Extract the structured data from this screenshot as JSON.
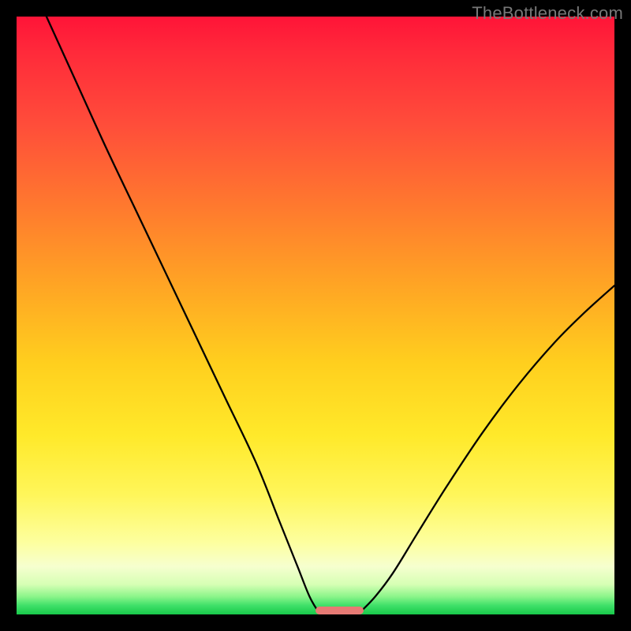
{
  "watermark": "TheBottleneck.com",
  "chart_data": {
    "type": "line",
    "title": "",
    "xlabel": "",
    "ylabel": "",
    "xlim": [
      0,
      100
    ],
    "ylim": [
      0,
      100
    ],
    "grid": false,
    "legend": false,
    "description": "Bottleneck curve: two descending arms meeting at a minimum, over a vertical heat gradient (red high → green low).",
    "series": [
      {
        "name": "left-arm",
        "x": [
          5,
          10,
          15,
          20,
          25,
          30,
          35,
          40,
          44,
          47,
          49,
          50.5
        ],
        "values": [
          100,
          89,
          78,
          67.5,
          57,
          46.5,
          36,
          25.5,
          15.5,
          8,
          3,
          0.4
        ]
      },
      {
        "name": "right-arm",
        "x": [
          57.5,
          60,
          63,
          67,
          72,
          78,
          84,
          90,
          95,
          100
        ],
        "values": [
          0.4,
          3,
          7,
          13.5,
          21.5,
          30.5,
          38.5,
          45.5,
          50.5,
          55
        ]
      }
    ],
    "minimum_marker": {
      "x_start": 50,
      "x_end": 58,
      "y": 0
    },
    "gradient_stops": [
      {
        "pos": 0,
        "color": "#ff1438"
      },
      {
        "pos": 18,
        "color": "#ff4d3a"
      },
      {
        "pos": 45,
        "color": "#ffa524"
      },
      {
        "pos": 70,
        "color": "#ffe92a"
      },
      {
        "pos": 92,
        "color": "#f6ffcf"
      },
      {
        "pos": 100,
        "color": "#18c94a"
      }
    ]
  }
}
